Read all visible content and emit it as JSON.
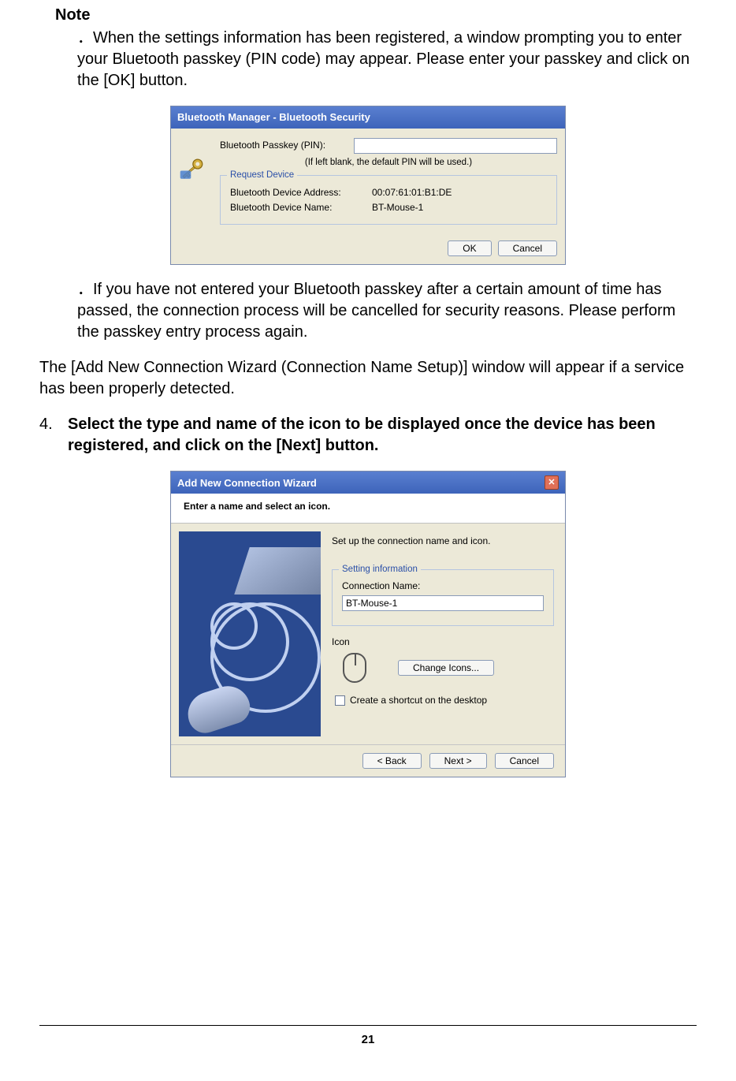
{
  "note": {
    "heading": "Note",
    "bullet_prefix": "．",
    "item1": "When the settings information has been registered, a window prompting you to enter your Bluetooth passkey (PIN code) may appear. Please enter your passkey and click on the [OK] button.",
    "item2": "If you have not entered your Bluetooth passkey after a certain amount of time has passed, the connection process will be cancelled for security reasons. Please perform the passkey entry process again."
  },
  "dialog1": {
    "title": "Bluetooth Manager - Bluetooth Security",
    "pin_label": "Bluetooth Passkey (PIN):",
    "pin_value": "",
    "pin_hint": "(If left blank, the default PIN will be used.)",
    "group_legend": "Request Device",
    "addr_label": "Bluetooth Device Address:",
    "addr_value": "00:07:61:01:B1:DE",
    "name_label": "Bluetooth Device Name:",
    "name_value": "BT-Mouse-1",
    "ok": "OK",
    "cancel": "Cancel"
  },
  "para1": "The [Add New Connection Wizard (Connection Name Setup)] window will appear if a service has been properly detected.",
  "step4": {
    "num": "4.",
    "text": "Select the type and name of the icon to be displayed once the device has been registered, and click on the [Next] button."
  },
  "dialog2": {
    "title": "Add New Connection Wizard",
    "header": "Enter a name and select an icon.",
    "intro": "Set up the connection name and icon.",
    "group_legend": "Setting information",
    "cn_label": "Connection Name:",
    "cn_value": "BT-Mouse-1",
    "icon_label": "Icon",
    "change_btn": "Change Icons...",
    "shortcut_label": "Create a shortcut on the desktop",
    "shortcut_checked": false,
    "back": "< Back",
    "next": "Next >",
    "cancel": "Cancel"
  },
  "page_number": "21"
}
